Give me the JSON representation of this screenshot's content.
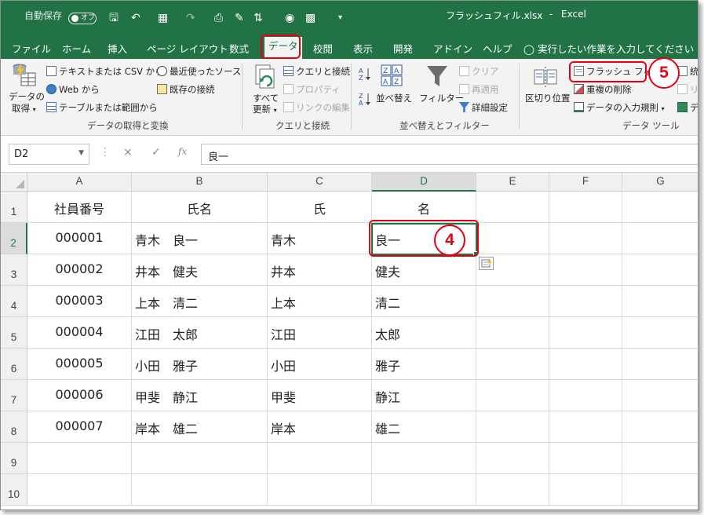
{
  "titlebar": {
    "autosave_label": "自動保存",
    "autosave_state": "オフ",
    "filename": "フラッシュフィル.xlsx",
    "separator": "-",
    "app_name": "Excel"
  },
  "tabs": [
    "ファイル",
    "ホーム",
    "挿入",
    "ページ レイアウト",
    "数式",
    "データ",
    "校閲",
    "表示",
    "開発",
    "アドイン",
    "ヘルプ"
  ],
  "active_tab": "データ",
  "tell_me": "実行したい作業を入力してください",
  "ribbon": {
    "get_data": {
      "big_label_1": "データの",
      "big_label_2": "取得",
      "from_text_csv": "テキストまたは CSV から",
      "from_web": "Web から",
      "from_table": "テーブルまたは範囲から",
      "recent_sources": "最近使ったソース",
      "existing_connections": "既存の接続",
      "group_label": "データの取得と変換"
    },
    "queries": {
      "refresh_label_1": "すべて",
      "refresh_label_2": "更新",
      "queries_connections": "クエリと接続",
      "properties": "プロパティ",
      "edit_links": "リンクの編集",
      "group_label": "クエリと接続"
    },
    "sort_filter": {
      "sort": "並べ替え",
      "filter": "フィルター",
      "clear": "クリア",
      "reapply": "再適用",
      "advanced": "詳細設定",
      "group_label": "並べ替えとフィルター"
    },
    "data_tools": {
      "text_to_columns": "区切り位置",
      "flash_fill": "フラッシュ フィル",
      "remove_duplicates": "重複の削除",
      "data_validation": "データの入力規則",
      "group_label": "データ ツール",
      "partial_1": "統",
      "partial_2": "リ",
      "partial_3": "デ"
    }
  },
  "formula_bar": {
    "name_box": "D2",
    "cancel": "×",
    "enter": "✓",
    "fx": "fx",
    "value": "良一"
  },
  "grid": {
    "columns": [
      "A",
      "B",
      "C",
      "D",
      "E",
      "F",
      "G"
    ],
    "selected_cell": "D2",
    "rows": [
      {
        "num": "1",
        "cells": [
          "社員番号",
          "氏名",
          "氏",
          "名",
          "",
          "",
          ""
        ]
      },
      {
        "num": "2",
        "cells": [
          "000001",
          "青木　良一",
          "青木",
          "良一",
          "",
          "",
          ""
        ]
      },
      {
        "num": "3",
        "cells": [
          "000002",
          "井本　健夫",
          "井本",
          "健夫",
          "",
          "",
          ""
        ]
      },
      {
        "num": "4",
        "cells": [
          "000003",
          "上本　清二",
          "上本",
          "清二",
          "",
          "",
          ""
        ]
      },
      {
        "num": "5",
        "cells": [
          "000004",
          "江田　太郎",
          "江田",
          "太郎",
          "",
          "",
          ""
        ]
      },
      {
        "num": "6",
        "cells": [
          "000005",
          "小田　雅子",
          "小田",
          "雅子",
          "",
          "",
          ""
        ]
      },
      {
        "num": "7",
        "cells": [
          "000006",
          "甲斐　静江",
          "甲斐",
          "静江",
          "",
          "",
          ""
        ]
      },
      {
        "num": "8",
        "cells": [
          "000007",
          "岸本　雄二",
          "岸本",
          "雄二",
          "",
          "",
          ""
        ]
      },
      {
        "num": "9",
        "cells": [
          "",
          "",
          "",
          "",
          "",
          "",
          ""
        ]
      },
      {
        "num": "10",
        "cells": [
          "",
          "",
          "",
          "",
          "",
          "",
          ""
        ]
      }
    ]
  },
  "annotations": {
    "step4": "4",
    "step5": "5",
    "color": "#e60012"
  },
  "colors": {
    "excel_green": "#217346",
    "ribbon_bg": "#f3f3f3"
  }
}
